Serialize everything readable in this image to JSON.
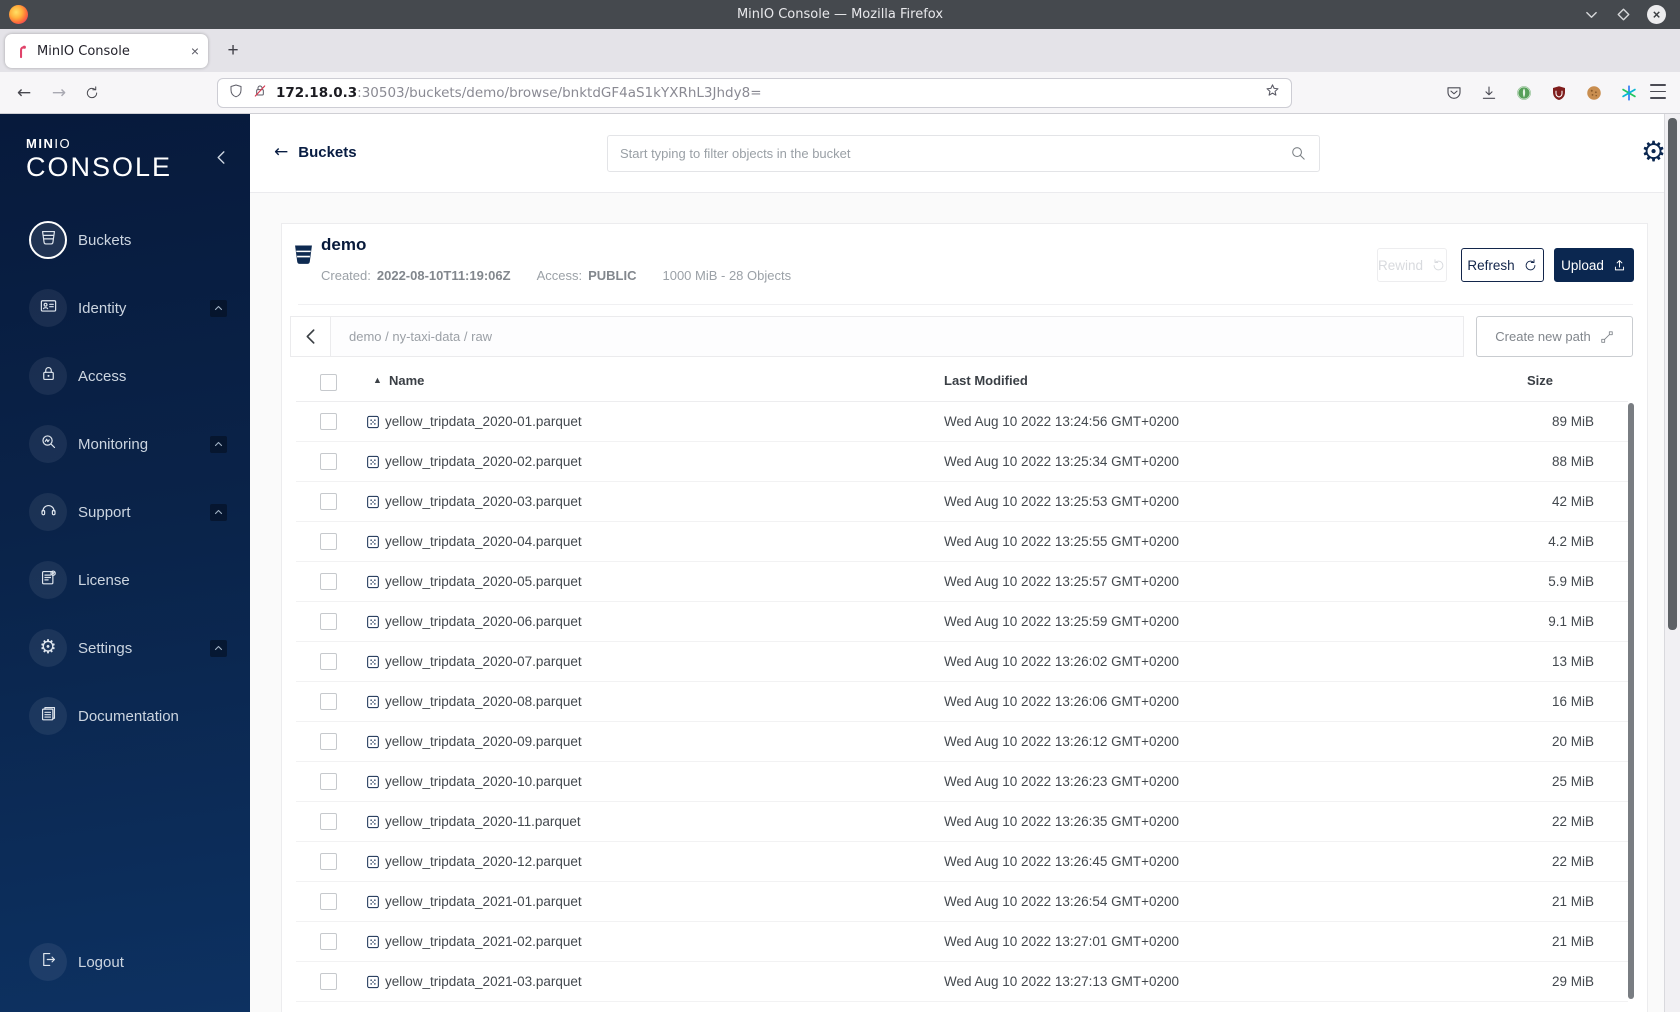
{
  "browser": {
    "window_title": "MinIO Console — Mozilla Firefox",
    "tab_title": "MinIO Console",
    "url_host": "172.18.0.3",
    "url_path": ":30503/buckets/demo/browse/bnktdGF4aS1kYXRhL3Jhdy8=",
    "window_controls": [
      "minimize",
      "maximize",
      "close"
    ],
    "toolbar_icons": [
      {
        "icon": "pocket-icon"
      },
      {
        "icon": "download-icon"
      },
      {
        "icon": "privacy-extension-icon"
      },
      {
        "icon": "ublock-extension-icon"
      },
      {
        "icon": "cookie-extension-icon"
      },
      {
        "icon": "container-extension-icon"
      }
    ]
  },
  "sidebar": {
    "brand_bold": "MIN",
    "brand_light": "IO",
    "product": "CONSOLE",
    "items": [
      {
        "label": "Buckets",
        "icon": "bucket-icon",
        "active": true,
        "expandable": false
      },
      {
        "label": "Identity",
        "icon": "identity-icon",
        "active": false,
        "expandable": true
      },
      {
        "label": "Access",
        "icon": "access-icon",
        "active": false,
        "expandable": false
      },
      {
        "label": "Monitoring",
        "icon": "monitoring-icon",
        "active": false,
        "expandable": true
      },
      {
        "label": "Support",
        "icon": "support-icon",
        "active": false,
        "expandable": true
      },
      {
        "label": "License",
        "icon": "license-icon",
        "active": false,
        "expandable": false
      },
      {
        "label": "Settings",
        "icon": "settings-icon",
        "active": false,
        "expandable": true
      },
      {
        "label": "Documentation",
        "icon": "documentation-icon",
        "active": false,
        "expandable": false
      }
    ],
    "logout_label": "Logout"
  },
  "topbar": {
    "back_label": "Buckets",
    "search_placeholder": "Start typing to filter objects in the bucket"
  },
  "bucket": {
    "name": "demo",
    "created_label": "Created:",
    "created_value": "2022-08-10T11:19:06Z",
    "access_label": "Access:",
    "access_value": "PUBLIC",
    "summary": "1000 MiB - 28 Objects",
    "rewind_label": "Rewind",
    "refresh_label": "Refresh",
    "upload_label": "Upload"
  },
  "pathbar": {
    "breadcrumb": "demo / ny-taxi-data / raw",
    "create_label": "Create new path"
  },
  "table": {
    "name_header": "Name",
    "modified_header": "Last Modified",
    "size_header": "Size",
    "rows": [
      {
        "name": "yellow_tripdata_2020-01.parquet",
        "modified": "Wed Aug 10 2022 13:24:56 GMT+0200",
        "size": "89 MiB"
      },
      {
        "name": "yellow_tripdata_2020-02.parquet",
        "modified": "Wed Aug 10 2022 13:25:34 GMT+0200",
        "size": "88 MiB"
      },
      {
        "name": "yellow_tripdata_2020-03.parquet",
        "modified": "Wed Aug 10 2022 13:25:53 GMT+0200",
        "size": "42 MiB"
      },
      {
        "name": "yellow_tripdata_2020-04.parquet",
        "modified": "Wed Aug 10 2022 13:25:55 GMT+0200",
        "size": "4.2 MiB"
      },
      {
        "name": "yellow_tripdata_2020-05.parquet",
        "modified": "Wed Aug 10 2022 13:25:57 GMT+0200",
        "size": "5.9 MiB"
      },
      {
        "name": "yellow_tripdata_2020-06.parquet",
        "modified": "Wed Aug 10 2022 13:25:59 GMT+0200",
        "size": "9.1 MiB"
      },
      {
        "name": "yellow_tripdata_2020-07.parquet",
        "modified": "Wed Aug 10 2022 13:26:02 GMT+0200",
        "size": "13 MiB"
      },
      {
        "name": "yellow_tripdata_2020-08.parquet",
        "modified": "Wed Aug 10 2022 13:26:06 GMT+0200",
        "size": "16 MiB"
      },
      {
        "name": "yellow_tripdata_2020-09.parquet",
        "modified": "Wed Aug 10 2022 13:26:12 GMT+0200",
        "size": "20 MiB"
      },
      {
        "name": "yellow_tripdata_2020-10.parquet",
        "modified": "Wed Aug 10 2022 13:26:23 GMT+0200",
        "size": "25 MiB"
      },
      {
        "name": "yellow_tripdata_2020-11.parquet",
        "modified": "Wed Aug 10 2022 13:26:35 GMT+0200",
        "size": "22 MiB"
      },
      {
        "name": "yellow_tripdata_2020-12.parquet",
        "modified": "Wed Aug 10 2022 13:26:45 GMT+0200",
        "size": "22 MiB"
      },
      {
        "name": "yellow_tripdata_2021-01.parquet",
        "modified": "Wed Aug 10 2022 13:26:54 GMT+0200",
        "size": "21 MiB"
      },
      {
        "name": "yellow_tripdata_2021-02.parquet",
        "modified": "Wed Aug 10 2022 13:27:01 GMT+0200",
        "size": "21 MiB"
      },
      {
        "name": "yellow_tripdata_2021-03.parquet",
        "modified": "Wed Aug 10 2022 13:27:13 GMT+0200",
        "size": "29 MiB"
      }
    ]
  }
}
